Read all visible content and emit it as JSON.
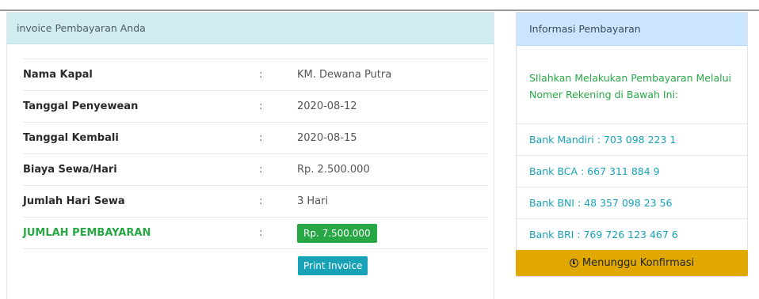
{
  "invoice_card": {
    "header": "invoice Pembayaran Anda",
    "colon": ":",
    "rows": [
      {
        "label": "Nama Kapal",
        "value": "KM. Dewana Putra"
      },
      {
        "label": "Tanggal Penyewean",
        "value": "2020-08-12"
      },
      {
        "label": "Tanggal Kembali",
        "value": "2020-08-15"
      },
      {
        "label": "Biaya Sewa/Hari",
        "value": "Rp. 2.500.000"
      },
      {
        "label": "Jumlah Hari Sewa",
        "value": "3 Hari"
      }
    ],
    "total": {
      "label": "JUMLAH PEMBAYARAN",
      "value": "Rp. 7.500.000"
    },
    "print_button": "Print Invoice"
  },
  "payment_card": {
    "header": "Informasi Pembayaran",
    "intro": "SIlahkan Melakukan Pembayaran Melalui Nomer Rekening di Bawah Ini:",
    "banks": [
      "Bank Mandiri : 703 098 223 1",
      "Bank BCA : 667 311 884 9",
      "Bank BNI : 48 357 098 23 56",
      "Bank BRI : 769 726 123 467 6"
    ],
    "status_button": "Menunggu Konfirmasi",
    "status_icon": "clock-icon"
  },
  "colors": {
    "invoice_header_bg": "#d1ecf1",
    "payment_header_bg": "#cce5ff",
    "success": "#28a745",
    "info": "#17a2b8",
    "warning": "#e0a800"
  }
}
